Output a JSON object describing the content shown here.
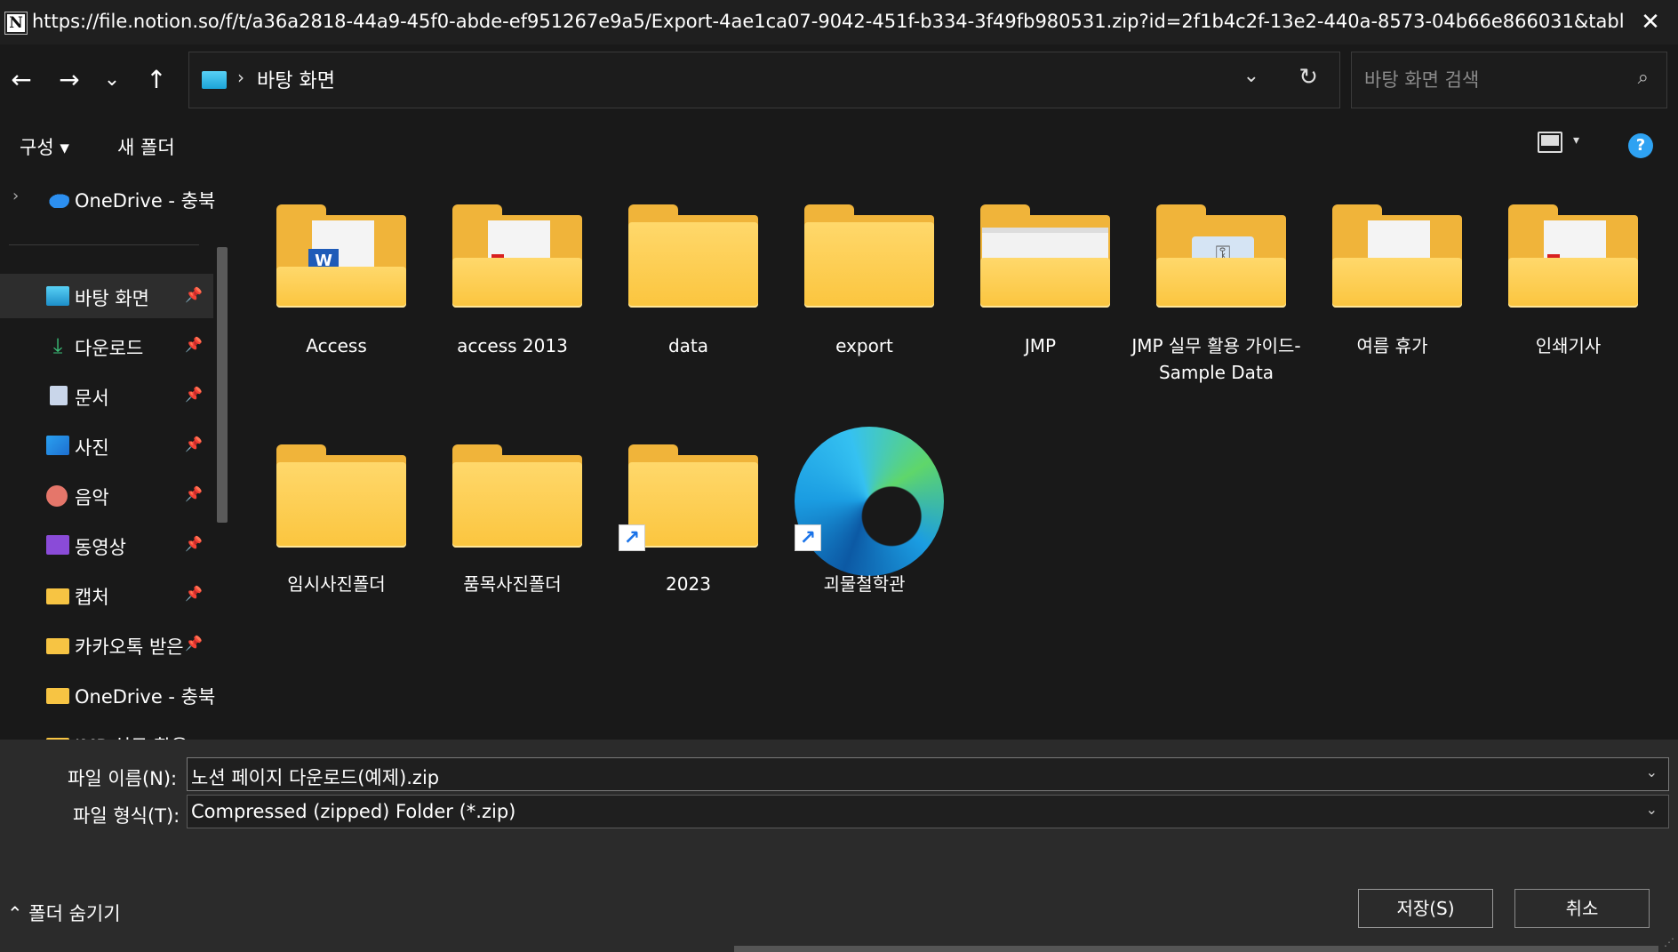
{
  "window": {
    "title": "https://file.notion.so/f/t/a36a2818-44a9-45f0-abde-ef951267e9a5/Export-4ae1ca07-9042-451f-b334-3f49fb980531.zip?id=2f1b4c2f-13e2-440a-8573-04b66e866031&table=user_export&expir...",
    "app_icon": "N",
    "close_icon": "✕"
  },
  "nav": {
    "back": "←",
    "forward": "→",
    "recent": "⌄",
    "up": "↑",
    "address": {
      "separator": "›",
      "location": "바탕 화면",
      "dropdown": "⌄",
      "refresh": "↻"
    },
    "search": {
      "placeholder": "바탕 화면 검색",
      "icon": "⌕"
    }
  },
  "toolbar": {
    "organize": "구성 ▾",
    "new_folder": "새 폴더",
    "view_caret": "▾",
    "help": "?"
  },
  "sidebar": {
    "expand": "›",
    "onedrive": "OneDrive - 충북",
    "pin": "📌",
    "items": [
      {
        "label": "바탕 화면",
        "icon": "desktop-icon"
      },
      {
        "label": "다운로드",
        "icon": "download-icon"
      },
      {
        "label": "문서",
        "icon": "documents-icon"
      },
      {
        "label": "사진",
        "icon": "pictures-icon"
      },
      {
        "label": "음악",
        "icon": "music-icon"
      },
      {
        "label": "동영상",
        "icon": "videos-icon"
      },
      {
        "label": "캡처",
        "icon": "folder-icon"
      },
      {
        "label": "카카오톡 받은",
        "icon": "folder-icon"
      },
      {
        "label": "OneDrive - 충북",
        "icon": "folder-icon"
      },
      {
        "label": "JMP 실무 활용 :",
        "icon": "folder-icon"
      }
    ]
  },
  "files": [
    {
      "name": "Access",
      "type": "folder"
    },
    {
      "name": "access 2013",
      "type": "folder"
    },
    {
      "name": "data",
      "type": "folder"
    },
    {
      "name": "export",
      "type": "folder"
    },
    {
      "name": "JMP",
      "type": "folder"
    },
    {
      "name": "JMP 실무 활용 가이드-Sample Data",
      "type": "folder"
    },
    {
      "name": "여름 휴가",
      "type": "folder"
    },
    {
      "name": "인쇄기사",
      "type": "folder"
    },
    {
      "name": "임시사진폴더",
      "type": "folder"
    },
    {
      "name": "품목사진폴더",
      "type": "folder"
    },
    {
      "name": "2023",
      "type": "folder-shortcut"
    },
    {
      "name": "괴물철학관",
      "type": "edge-shortcut"
    }
  ],
  "form": {
    "filename_label": "파일 이름(N):",
    "filename_value": "노션 페이지 다운로드(예제).zip",
    "filetype_label": "파일 형식(T):",
    "filetype_value": "Compressed (zipped) Folder (*.zip)",
    "dropdown": "⌄",
    "hide_folders": "⌃ 폴더 숨기기",
    "save": "저장(S)",
    "cancel": "취소"
  }
}
